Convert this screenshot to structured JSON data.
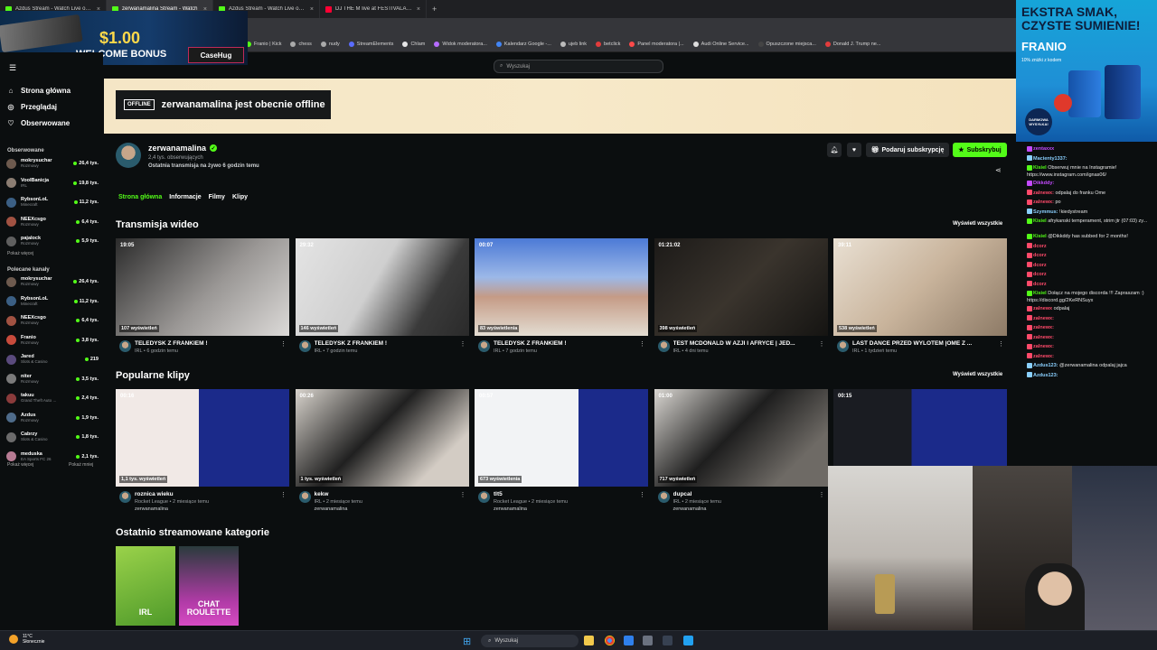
{
  "browser": {
    "tabs": [
      {
        "label": "Azdus Stream - Watch Live on K",
        "color": "#53fc18",
        "active": false
      },
      {
        "label": "zerwanamalina Stream - Watch",
        "color": "#53fc18",
        "active": true
      },
      {
        "label": "Azdus Stream - Watch Live on K",
        "color": "#53fc18",
        "active": false
      },
      {
        "label": "DJ THE M live at FESTIVALAND",
        "color": "#ff0033",
        "active": false
      }
    ],
    "bookmarks": [
      "Franio | Kick",
      "chess",
      "nudy",
      "StreamElements",
      "Chlam",
      "Widok moderatora...",
      "Kalendarz Google -...",
      "ujeb link",
      "betclick",
      "Panel moderatora |...",
      "Audi Online Service...",
      "Opuszczone miejsca...",
      "Donald J. Trump ne..."
    ]
  },
  "ads": {
    "left": {
      "amount": "$1.00",
      "bonus": "WELCOME BONUS",
      "brand": "CaseHug"
    },
    "right": {
      "line1": "EKSTRA SMAK,",
      "line2": "CZYSTE SUMIENIE!",
      "brand": "FRANIO",
      "small": "10% zniżki z kodem",
      "badge": "DARMOWA WYSYŁKA!"
    }
  },
  "sidebar": {
    "nav": [
      {
        "label": "Strona główna",
        "icon": "home-icon"
      },
      {
        "label": "Przeglądaj",
        "icon": "compass-icon"
      },
      {
        "label": "Obserwowane",
        "icon": "heart-icon"
      }
    ],
    "followed_title": "Obserwowane",
    "followed": [
      {
        "name": "mokrysuchar",
        "cat": "Rozmowy",
        "views": "26,4 tys.",
        "color": "#6d5a4e"
      },
      {
        "name": "VoolBanicja",
        "cat": "IRL",
        "views": "19,8 tys.",
        "color": "#8b7d72"
      },
      {
        "name": "RybsonLoL",
        "cat": "Minecraft",
        "views": "11,2 tys.",
        "color": "#3b5f84"
      },
      {
        "name": "NEEXcsgo",
        "cat": "Rozmowy",
        "views": "6,4 tys.",
        "color": "#a15242"
      },
      {
        "name": "pajalock",
        "cat": "Rozmowy",
        "views": "5,9 tys.",
        "color": "#5f5f5f"
      }
    ],
    "more_followed": "Pokaż więcej",
    "recommended_title": "Polecane kanały",
    "recommended": [
      {
        "name": "mokrysuchar",
        "cat": "Rozmowy",
        "views": "26,4 tys.",
        "color": "#6d5a4e"
      },
      {
        "name": "RybsonLoL",
        "cat": "Minecraft",
        "views": "11,2 tys.",
        "color": "#3b5f84"
      },
      {
        "name": "NEEXcsgo",
        "cat": "Rozmowy",
        "views": "6,4 tys.",
        "color": "#a15242"
      },
      {
        "name": "Franio",
        "cat": "Rozmowy",
        "views": "3,8 tys.",
        "color": "#c84b3c"
      },
      {
        "name": "Jared",
        "cat": "Slots & Casino",
        "views": "219",
        "color": "#5a4a7d"
      },
      {
        "name": "niter",
        "cat": "Rozmowy",
        "views": "3,5 tys.",
        "color": "#7a7a7a"
      },
      {
        "name": "takuu",
        "cat": "Grand Theft Auto ...",
        "views": "2,4 tys.",
        "color": "#8a3b3b"
      },
      {
        "name": "Azdus",
        "cat": "Rozmowy",
        "views": "1,9 tys.",
        "color": "#4e6b8a"
      },
      {
        "name": "Cabrzy",
        "cat": "Slots & Casino",
        "views": "1,8 tys.",
        "color": "#6b6b6b"
      },
      {
        "name": "meduska",
        "cat": "EA Sports FC 26",
        "views": "2,1 tys.",
        "color": "#b77b93"
      }
    ],
    "more_left": "Pokaż więcej",
    "more_right": "Pokaż mniej"
  },
  "search": {
    "placeholder": "Wyszukaj"
  },
  "offline": {
    "tag": "OFFLINE",
    "text": "zerwanamalina jest obecnie offline"
  },
  "profile": {
    "name": "zerwanamalina",
    "followers": "2,4 tys. obserwujących",
    "last_stream": "Ostatnia transmisja na żywo 6 godzin temu",
    "gift_label": "Podaruj subskrypcję",
    "sub_label": "Subskrybuj"
  },
  "tabs": [
    {
      "label": "Strona główna",
      "active": true
    },
    {
      "label": "Informacje",
      "active": false
    },
    {
      "label": "Filmy",
      "active": false
    },
    {
      "label": "Klipy",
      "active": false
    }
  ],
  "videos": {
    "title": "Transmisja wideo",
    "see_all": "Wyświetl wszystkie",
    "items": [
      {
        "duration": "19:05",
        "views": "107 wyświetleń",
        "title": "TELEDYSK Z FRANKIEM !",
        "meta": "IRL • 6 godzin temu",
        "bg": "linear-gradient(135deg,#2b2b2b,#9a9795 55%,#dcdad8)"
      },
      {
        "duration": "29:32",
        "views": "146 wyświetleń",
        "title": "TELEDYSK Z FRANKIEM !",
        "meta": "IRL • 7 godzin temu",
        "bg": "linear-gradient(120deg,#e4e4e4,#cfcfcf 45%,#3a3a3a 75%,#2a2a2a)"
      },
      {
        "duration": "00:07",
        "views": "83 wyświetlenia",
        "title": "TELEDYSK Z FRANKIEM !",
        "meta": "IRL • 7 godzin temu",
        "bg": "linear-gradient(180deg,#4c7ad6,#9cb8e8 40%,#c59b86 60%,#e3ddd2)"
      },
      {
        "duration": "01:21:02",
        "views": "398 wyświetleń",
        "title": "TEST MCDONALD W AZJI I AFRYCE | JED...",
        "meta": "IRL • 4 dni temu",
        "bg": "linear-gradient(135deg,#1c1a18,#3a342d 50%,#151412)"
      },
      {
        "duration": "39:11",
        "views": "538 wyświetleń",
        "title": "LAST DANCE PRZED WYLOTEM |OME Z ...",
        "meta": "IRL • 1 tydzień temu",
        "bg": "linear-gradient(135deg,#e9e0d3,#c9b49c 50%,#8d7a66)"
      }
    ]
  },
  "clips": {
    "title": "Popularne klipy",
    "see_all": "Wyświetl wszystkie",
    "items": [
      {
        "duration": "00:16",
        "views": "1,1 tys. wyświetleń",
        "title": "roznica wieku",
        "meta": "Rocket League • 2 miesiące temu",
        "author": "zerwanamalina",
        "bg": "linear-gradient(90deg,#f1e9e6 0 48%,#1b2a8a 48% 100%)"
      },
      {
        "duration": "00:26",
        "views": "1 tys. wyświetleń",
        "title": "kekw",
        "meta": "IRL • 2 miesiące temu",
        "author": "zerwanamalina",
        "bg": "linear-gradient(135deg,#d8d3cc,#202020 45%,#d3ccc4 80%)"
      },
      {
        "duration": "00:57",
        "views": "673 wyświetlenia",
        "title": "tlt5",
        "meta": "Rocket League • 2 miesiące temu",
        "author": "zerwanamalina",
        "bg": "linear-gradient(90deg,#f2f3f5 0 60%,#1b2a8a 60% 100%)"
      },
      {
        "duration": "01:00",
        "views": "717 wyświetleń",
        "title": "dupcal",
        "meta": "IRL • 2 miesiące temu",
        "author": "zerwanamalina",
        "bg": "linear-gradient(135deg,#d9d6d1,#1e1e1e 45%,#6e6a65 80%)"
      },
      {
        "duration": "00:15",
        "views": "",
        "title": "",
        "meta": "",
        "author": "",
        "bg": "linear-gradient(90deg,#1a1c22 0 45%,#1b2a8a 45% 100%)"
      }
    ]
  },
  "categories": {
    "title": "Ostatnio streamowane kategorie",
    "items": [
      {
        "label": "IRL",
        "bg": "linear-gradient(160deg,#9ad24a,#4f9a2a)"
      },
      {
        "label": "CHAT ROULETTE",
        "bg": "linear-gradient(180deg,#2a3b3c,#b13ba7 70%,#d64bc3)"
      }
    ]
  },
  "chat": [
    {
      "user": "zentaxxx",
      "color": "#c44aff",
      "text": ""
    },
    {
      "user": "Macienty1337:",
      "color": "#8ad0ff",
      "text": ""
    },
    {
      "user": "Kisiel",
      "color": "#53fc18",
      "text": "Obserwuj mnie na Instagramie! https://www.instagram.com/ignas06/"
    },
    {
      "user": "Dikkddy:",
      "color": "#c44aff",
      "text": ""
    },
    {
      "user": "zalnewx:",
      "color": "#ff4a6a",
      "text": "odpalaj do franku Ome"
    },
    {
      "user": "zalnewx:",
      "color": "#ff4a6a",
      "text": "po"
    },
    {
      "user": "Szymmus:",
      "color": "#8ad0ff",
      "text": "!kiedystream"
    },
    {
      "user": "Kisiel",
      "color": "#53fc18",
      "text": "afrykanski temperament, strim jtr (07:03) zy..."
    },
    {
      "user": "Kisiel",
      "color": "#53fc18",
      "text": "@Dikkddy has subbed for 2 months!"
    },
    {
      "user": "dcorz",
      "color": "#ff4a6a",
      "text": ""
    },
    {
      "user": "dcorz",
      "color": "#ff4a6a",
      "text": ""
    },
    {
      "user": "dcorz",
      "color": "#ff4a6a",
      "text": ""
    },
    {
      "user": "dcorz",
      "color": "#ff4a6a",
      "text": ""
    },
    {
      "user": "dcorz",
      "color": "#ff4a6a",
      "text": ""
    },
    {
      "user": "Kisiel",
      "color": "#53fc18",
      "text": "Dołącz na mojego discorda !!! Zapraszam :) https://discord.gg/2KeRNSuyx"
    },
    {
      "user": "zalnewx",
      "color": "#ff4a6a",
      "text": "odpalaj"
    },
    {
      "user": "zalnewx:",
      "color": "#ff4a6a",
      "text": ""
    },
    {
      "user": "zalnewx:",
      "color": "#ff4a6a",
      "text": ""
    },
    {
      "user": "zalnewx:",
      "color": "#ff4a6a",
      "text": ""
    },
    {
      "user": "zalnewx:",
      "color": "#ff4a6a",
      "text": ""
    },
    {
      "user": "zalnewx:",
      "color": "#ff4a6a",
      "text": ""
    },
    {
      "user": "Azdus123:",
      "color": "#8ad0ff",
      "text": "@zerwanamalina odpalaj jajca"
    },
    {
      "user": "Azdus123:",
      "color": "#8ad0ff",
      "text": ""
    }
  ],
  "taskbar": {
    "temp": "11°C",
    "weather": "Słonecznie",
    "search": "Wyszukaj"
  }
}
